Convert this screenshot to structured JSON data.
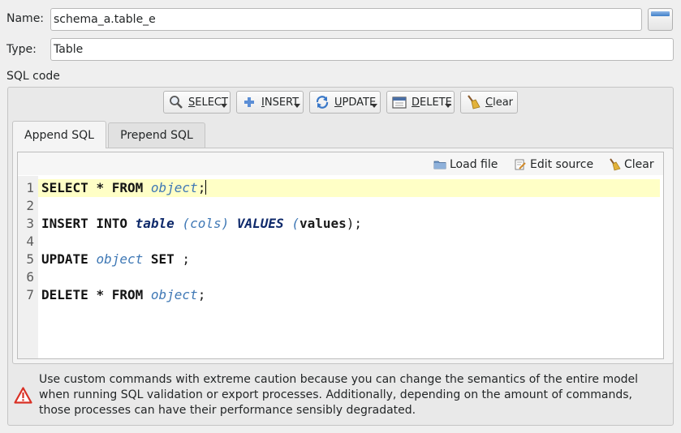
{
  "form": {
    "name_label": "Name:",
    "name_value": "schema_a.table_e",
    "type_label": "Type:",
    "type_value": "Table",
    "sql_code_label": "SQL code"
  },
  "toolbar": {
    "select": {
      "u": "S",
      "rest": "ELECT"
    },
    "insert": {
      "u": "I",
      "rest": "NSERT"
    },
    "update": {
      "u": "U",
      "rest": "PDATE"
    },
    "delete": {
      "u": "D",
      "rest": "ELETE"
    },
    "clear": {
      "u": "C",
      "rest": "lear"
    }
  },
  "tabs": [
    {
      "label": "Append SQL",
      "active": true
    },
    {
      "label": "Prepend SQL",
      "active": false
    }
  ],
  "editor_toolbar": {
    "load_file": "Load file",
    "edit_source": "Edit source",
    "clear": "Clear"
  },
  "editor": {
    "line_numbers": [
      "1",
      "2",
      "3",
      "4",
      "5",
      "6",
      "7"
    ],
    "tokens": {
      "select": "SELECT",
      "star": "*",
      "from": "FROM",
      "object": "object",
      "semi": ";",
      "insert_into": "INSERT INTO",
      "table": "table",
      "open_paren": "(",
      "cols": "cols",
      "close_paren": ")",
      "values_kw": "VALUES",
      "values": "values",
      "close_semi": ");",
      "update": "UPDATE",
      "set": "SET",
      "delete": "DELETE"
    }
  },
  "warning": {
    "text": "Use custom commands with extreme caution because you can change the semantics of the entire model when running SQL validation or export processes. Additionally, depending on the amount of commands, those processes can have their performance sensibly degradated."
  }
}
